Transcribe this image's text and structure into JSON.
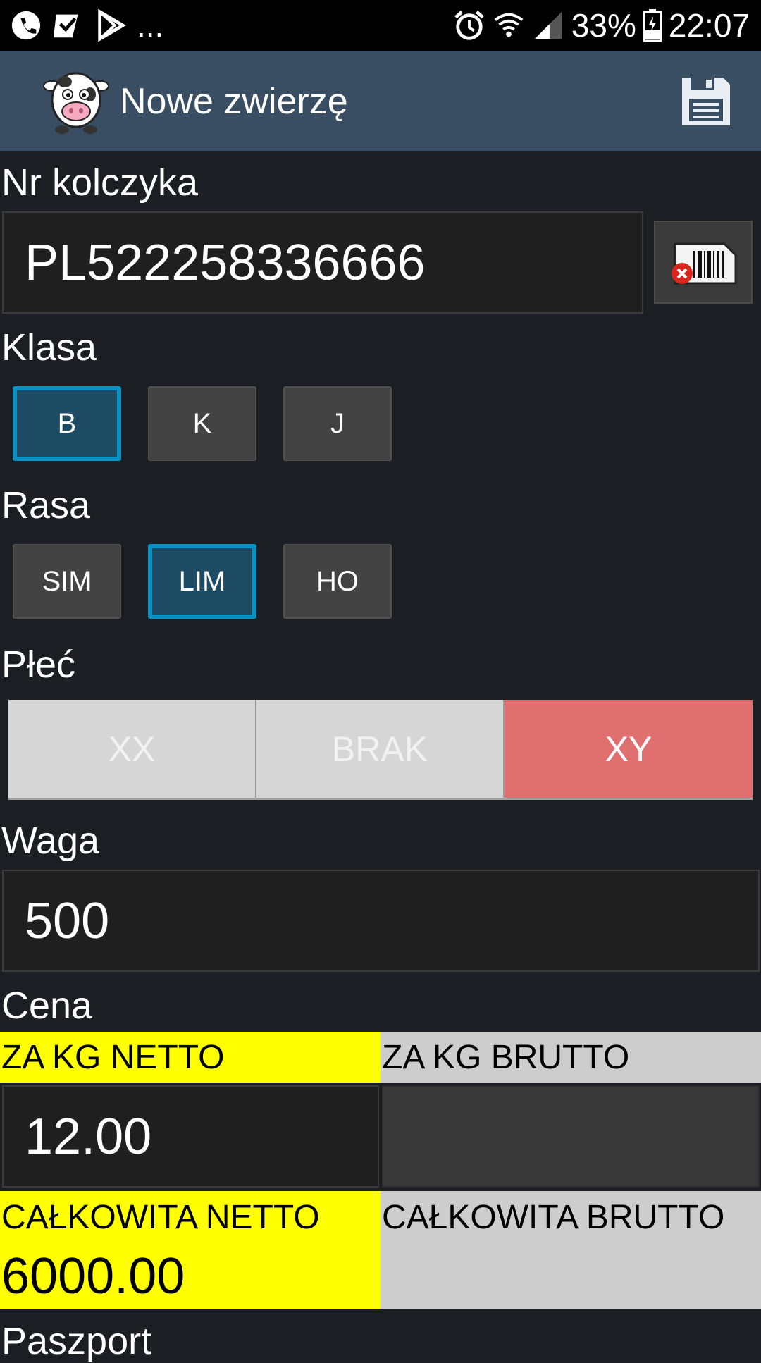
{
  "status_bar": {
    "battery": "33%",
    "time": "22:07",
    "more_indicator": "...",
    "icons_left": [
      "phone-icon",
      "check-icon",
      "play-store-icon"
    ],
    "icons_right": [
      "alarm-icon",
      "wifi-icon",
      "signal-icon",
      "battery-icon"
    ]
  },
  "app_bar": {
    "title": "Nowe zwierzę",
    "logo_icon": "cow-icon",
    "save_icon": "save-icon"
  },
  "ear_tag": {
    "label": "Nr kolczyka",
    "value": "PL522258336666",
    "scan_icon": "barcode-scan-icon"
  },
  "class": {
    "label": "Klasa",
    "options": [
      "B",
      "K",
      "J"
    ],
    "selected": "B"
  },
  "breed": {
    "label": "Rasa",
    "options": [
      "SIM",
      "LIM",
      "HO"
    ],
    "selected": "LIM"
  },
  "sex": {
    "label": "Płeć",
    "options": [
      "XX",
      "BRAK",
      "XY"
    ],
    "selected": "XY"
  },
  "weight": {
    "label": "Waga",
    "value": "500"
  },
  "price": {
    "label": "Cena",
    "per_kg_net_label": "ZA KG NETTO",
    "per_kg_gross_label": "ZA KG BRUTTO",
    "per_kg_net_value": "12.00",
    "per_kg_gross_value": "",
    "total_net_label": "CAŁKOWITA NETTO",
    "total_gross_label": "CAŁKOWITA BRUTTO",
    "total_net_value": "6000.00",
    "total_gross_value": ""
  },
  "passport": {
    "label": "Paszport"
  },
  "colors": {
    "app_bar": "#394e63",
    "selected_chip": "#1c4b63",
    "selected_border": "#0a93c2",
    "sex_active": "#e07070",
    "net_highlight": "#ffff00"
  }
}
